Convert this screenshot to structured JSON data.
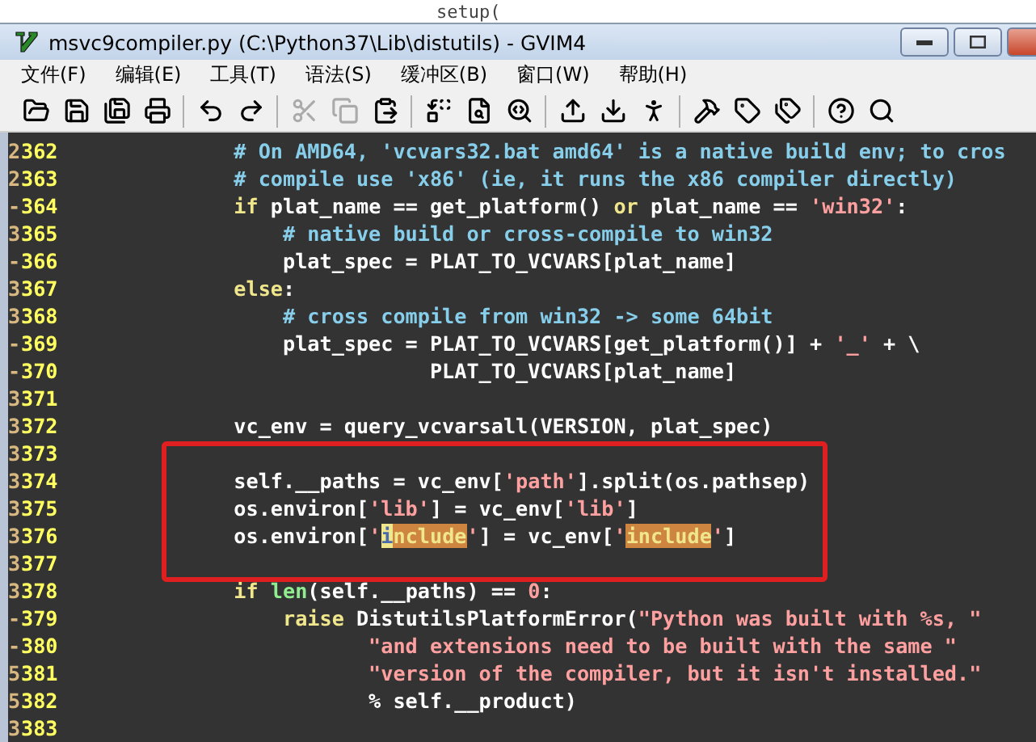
{
  "background_window": {
    "text": "setup("
  },
  "window": {
    "title": "msvc9compiler.py (C:\\Python37\\Lib\\distutils) - GVIM4"
  },
  "menu": [
    "文件(F)",
    "编辑(E)",
    "工具(T)",
    "语法(S)",
    "缓冲区(B)",
    "窗口(W)",
    "帮助(H)"
  ],
  "toolbar": [
    [
      {
        "disabled": false
      },
      {
        "disabled": false
      },
      {
        "disabled": false
      },
      {
        "disabled": false
      }
    ],
    [
      {
        "disabled": false
      },
      {
        "disabled": false
      }
    ],
    [
      {
        "disabled": true
      },
      {
        "disabled": true
      },
      {
        "disabled": false
      }
    ],
    [
      {
        "disabled": false
      },
      {
        "disabled": false
      },
      {
        "disabled": false
      }
    ],
    [
      {
        "disabled": false
      },
      {
        "disabled": false
      },
      {
        "disabled": false
      }
    ],
    [
      {
        "disabled": false
      },
      {
        "disabled": false
      },
      {
        "disabled": false
      }
    ],
    [
      {
        "disabled": false
      },
      {
        "disabled": false
      }
    ]
  ],
  "editor": {
    "lines": [
      {
        "fold": "2",
        "number": "362",
        "tokens": [
          {
            "kind": "comment",
            "text": "        # On AMD64, 'vcvars32.bat amd64' is a native build env; to cros"
          }
        ]
      },
      {
        "fold": "2",
        "number": "363",
        "tokens": [
          {
            "kind": "comment",
            "text": "        # compile use 'x86' (ie, it runs the x86 compiler directly)"
          }
        ]
      },
      {
        "fold": "-",
        "number": "364",
        "tokens": [
          {
            "kind": "keyword",
            "text": "        if"
          },
          {
            "kind": "plain",
            "text": " plat_name == get_platform() "
          },
          {
            "kind": "keyword",
            "text": "or"
          },
          {
            "kind": "plain",
            "text": " plat_name == "
          },
          {
            "kind": "string",
            "text": "'win32'"
          },
          {
            "kind": "plain",
            "text": ":"
          }
        ]
      },
      {
        "fold": "3",
        "number": "365",
        "tokens": [
          {
            "kind": "comment",
            "text": "            # native build or cross-compile to win32"
          }
        ]
      },
      {
        "fold": "-",
        "number": "366",
        "tokens": [
          {
            "kind": "plain",
            "text": "            plat_spec = PLAT_TO_VCVARS[plat_name]"
          }
        ]
      },
      {
        "fold": "3",
        "number": "367",
        "tokens": [
          {
            "kind": "keyword",
            "text": "        else"
          },
          {
            "kind": "plain",
            "text": ":"
          }
        ]
      },
      {
        "fold": "3",
        "number": "368",
        "tokens": [
          {
            "kind": "comment",
            "text": "            # cross compile from win32 -> some 64bit"
          }
        ]
      },
      {
        "fold": "-",
        "number": "369",
        "tokens": [
          {
            "kind": "plain",
            "text": "            plat_spec = PLAT_TO_VCVARS[get_platform()] + "
          },
          {
            "kind": "string",
            "text": "'_'"
          },
          {
            "kind": "plain",
            "text": " + \\"
          }
        ]
      },
      {
        "fold": "-",
        "number": "370",
        "tokens": [
          {
            "kind": "plain",
            "text": "                        PLAT_TO_VCVARS[plat_name]"
          }
        ]
      },
      {
        "fold": "3",
        "number": "371"
      },
      {
        "fold": "3",
        "number": "372",
        "tokens": [
          {
            "kind": "plain",
            "text": "        vc_env = query_vcvarsall(VERSION, plat_spec)"
          }
        ]
      },
      {
        "fold": "3",
        "number": "373"
      },
      {
        "fold": "3",
        "number": "374",
        "tokens": [
          {
            "kind": "plain",
            "text": "        self.__paths = vc_env["
          },
          {
            "kind": "string",
            "text": "'path'"
          },
          {
            "kind": "plain",
            "text": "].split(os.pathsep)"
          }
        ]
      },
      {
        "fold": "3",
        "number": "375",
        "tokens": [
          {
            "kind": "plain",
            "text": "        os.environ["
          },
          {
            "kind": "string",
            "text": "'lib'"
          },
          {
            "kind": "plain",
            "text": "] = vc_env["
          },
          {
            "kind": "string",
            "text": "'lib'"
          },
          {
            "kind": "plain",
            "text": "]"
          }
        ]
      },
      {
        "fold": "3",
        "number": "376",
        "tokens": [
          {
            "kind": "plain",
            "text": "        os.environ["
          },
          {
            "kind": "string",
            "text": "'"
          },
          {
            "kind": "cursor",
            "text": "i"
          },
          {
            "kind": "match",
            "text": "nclude"
          },
          {
            "kind": "string",
            "text": "'"
          },
          {
            "kind": "plain",
            "text": "] = vc_env["
          },
          {
            "kind": "string",
            "text": "'"
          },
          {
            "kind": "match",
            "text": "include"
          },
          {
            "kind": "string",
            "text": "'"
          },
          {
            "kind": "plain",
            "text": "]"
          }
        ]
      },
      {
        "fold": "3",
        "number": "377"
      },
      {
        "fold": "3",
        "number": "378",
        "tokens": [
          {
            "kind": "keyword",
            "text": "        if"
          },
          {
            "kind": "builtin",
            "text": " len"
          },
          {
            "kind": "plain",
            "text": "(self.__paths) == "
          },
          {
            "kind": "number",
            "text": "0"
          },
          {
            "kind": "plain",
            "text": ":"
          }
        ]
      },
      {
        "fold": "-",
        "number": "379",
        "tokens": [
          {
            "kind": "keyword",
            "text": "            raise"
          },
          {
            "kind": "plain",
            "text": " DistutilsPlatformError("
          },
          {
            "kind": "string",
            "text": "\"Python was built with %s, \""
          }
        ]
      },
      {
        "fold": "-",
        "number": "380",
        "tokens": [
          {
            "kind": "string",
            "text": "                   \"and extensions need to be built with the same \""
          }
        ]
      },
      {
        "fold": "5",
        "number": "381",
        "tokens": [
          {
            "kind": "string",
            "text": "                   \"version of the compiler, but it isn't installed.\""
          }
        ]
      },
      {
        "fold": "5",
        "number": "382",
        "tokens": [
          {
            "kind": "plain",
            "text": "                   % self.__product)"
          }
        ]
      },
      {
        "fold": "3",
        "number": "383"
      }
    ]
  }
}
